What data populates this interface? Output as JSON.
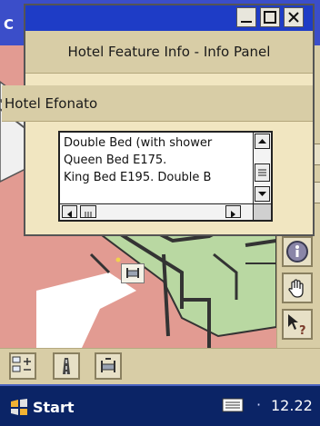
{
  "background_window": {
    "title_fragment": "C"
  },
  "dialog": {
    "header_title": "Hotel Feature Info - Info Panel",
    "hotel_name": "Hotel Efonato",
    "list_lines": [
      "Double Bed (with shower",
      "Queen Bed E175.",
      "King Bed E195. Double B"
    ],
    "title_buttons": [
      "minimize-icon",
      "maximize-icon",
      "close-icon"
    ]
  },
  "right_toolbar": {
    "icons": [
      "info-icon",
      "hand-pan-icon",
      "pointer-help-icon"
    ]
  },
  "bottom_toolbar": {
    "icons": [
      "zoom-layers-icon",
      "road-icon",
      "hotel-bed-icon"
    ]
  },
  "taskbar": {
    "start_label": "Start",
    "clock": "12.22",
    "separator": "·"
  },
  "colors": {
    "titlebar_blue": "#1e3cc6",
    "taskbar_navy": "#0b2466",
    "panel_tan": "#d8cda6",
    "map_pink": "#e29b92",
    "map_green": "#b9d8a2"
  }
}
